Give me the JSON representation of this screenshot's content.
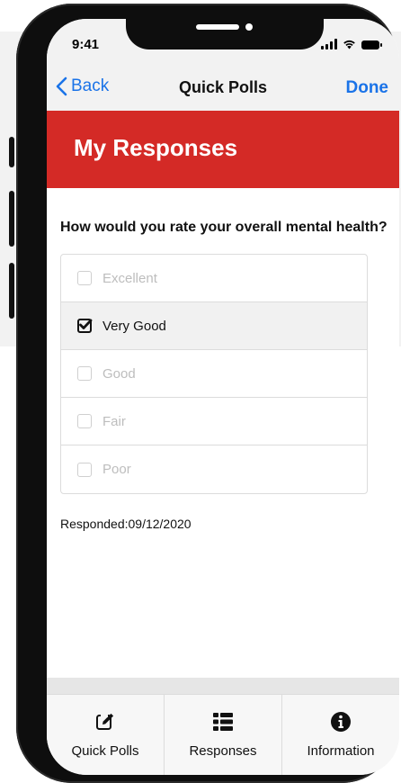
{
  "status_bar": {
    "time": "9:41"
  },
  "nav": {
    "back_label": "Back",
    "title": "Quick Polls",
    "done_label": "Done"
  },
  "header": {
    "title": "My Responses"
  },
  "poll": {
    "question": "How would you rate your overall mental health?",
    "options": [
      {
        "label": "Excellent",
        "checked": false
      },
      {
        "label": "Very Good",
        "checked": true
      },
      {
        "label": "Good",
        "checked": false
      },
      {
        "label": "Fair",
        "checked": false
      },
      {
        "label": "Poor",
        "checked": false
      }
    ],
    "responded": "Responded:09/12/2020"
  },
  "tabs": [
    {
      "label": "Quick Polls",
      "icon": "edit-icon"
    },
    {
      "label": "Responses",
      "icon": "list-icon"
    },
    {
      "label": "Information",
      "icon": "info-icon"
    }
  ],
  "colors": {
    "accent": "#d42a26",
    "link": "#1a73e8"
  }
}
